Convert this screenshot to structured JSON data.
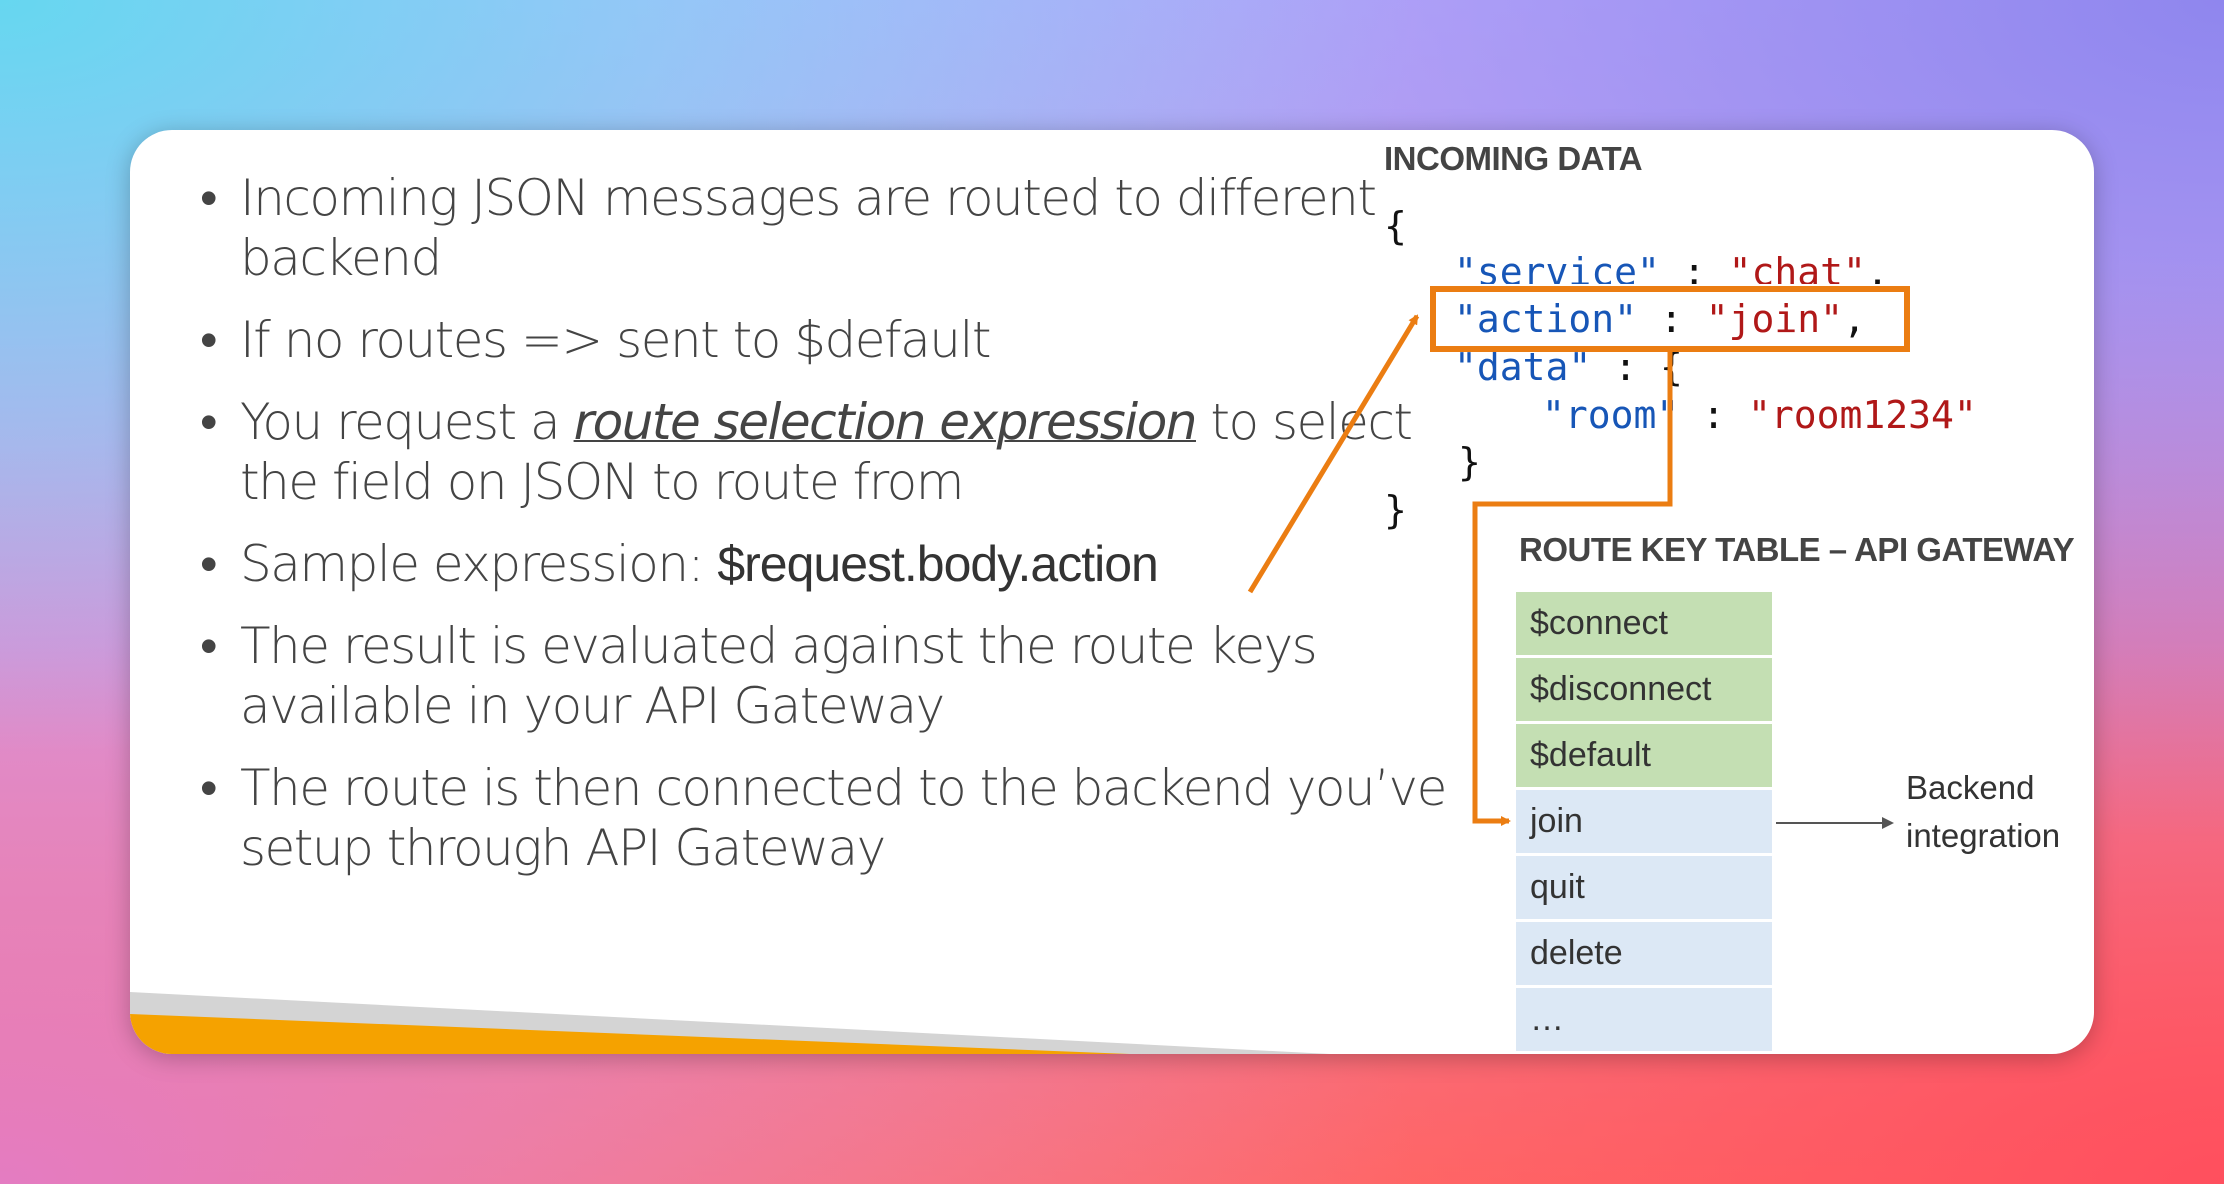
{
  "bullets": [
    {
      "segments": [
        {
          "text": "Incoming JSON messages are routed to different backend",
          "style": "normal"
        }
      ]
    },
    {
      "segments": [
        {
          "text": "If no routes => sent to $default",
          "style": "normal"
        }
      ]
    },
    {
      "segments": [
        {
          "text": "You request a ",
          "style": "normal"
        },
        {
          "text": "route selection expression",
          "style": "emphasis"
        },
        {
          "text": " to select the field on JSON to route from",
          "style": "normal"
        }
      ]
    },
    {
      "segments": [
        {
          "text": "Sample expression: ",
          "style": "normal"
        },
        {
          "text": "$request.body.action",
          "style": "strong"
        }
      ]
    },
    {
      "segments": [
        {
          "text": "The result is evaluated against the route keys available in your API Gateway",
          "style": "normal"
        }
      ]
    },
    {
      "segments": [
        {
          "text": "The route is then connected to the backend you’ve setup through API Gateway",
          "style": "normal"
        }
      ]
    }
  ],
  "incoming": {
    "title": "INCOMING DATA",
    "open_brace": "{",
    "close_brace": "}",
    "service_key": "\"service\"",
    "service_value": "\"chat\"",
    "action_key": "\"action\"",
    "action_value": "\"join\"",
    "data_key": "\"data\"",
    "room_key": "\"room\"",
    "room_value": "\"room1234\"",
    "colon": ":",
    "comma": ",",
    "inner_open_brace": "{",
    "inner_close_brace": "}"
  },
  "route_table": {
    "title": "ROUTE KEY TABLE – API GATEWAY",
    "rows": [
      {
        "label": "$connect",
        "kind": "green"
      },
      {
        "label": "$disconnect",
        "kind": "green"
      },
      {
        "label": "$default",
        "kind": "green"
      },
      {
        "label": "join",
        "kind": "blue"
      },
      {
        "label": "quit",
        "kind": "blue"
      },
      {
        "label": "delete",
        "kind": "blue"
      },
      {
        "label": "…",
        "kind": "blue"
      }
    ]
  },
  "backend": {
    "line1": "Backend",
    "line2": "integration"
  },
  "colors": {
    "highlight": "#eb7d12",
    "band_orange": "#f5a200",
    "band_gray": "#d4d4d4",
    "json_key": "#1756b7",
    "json_value": "#b01818"
  }
}
